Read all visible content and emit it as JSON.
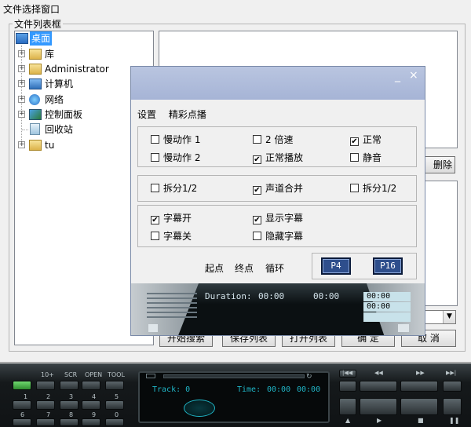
{
  "window": {
    "title": "文件选择窗口"
  },
  "group_label": "文件列表框",
  "tree": [
    {
      "label": "桌面",
      "selected": true,
      "icon": "desktop-icon"
    },
    {
      "label": "库",
      "icon": "library-icon"
    },
    {
      "label": "Administrator",
      "icon": "user-folder-icon"
    },
    {
      "label": "计算机",
      "icon": "computer-icon"
    },
    {
      "label": "网络",
      "icon": "network-icon"
    },
    {
      "label": "控制面板",
      "icon": "control-panel-icon"
    },
    {
      "label": "回收站",
      "icon": "recycle-bin-icon"
    },
    {
      "label": "tu",
      "icon": "folder-icon"
    }
  ],
  "buttons": {
    "delete": "删除",
    "start_search": "开始搜索",
    "save_list": "保存列表",
    "open_list": "打开列表",
    "ok": "确  定",
    "cancel": "取  消"
  },
  "popup": {
    "minimize": "_",
    "close": "×",
    "tabs": [
      "设置",
      "精彩点播"
    ],
    "speed": {
      "slow1": "慢动作 1",
      "x2": "2 倍速",
      "normal": "正常",
      "slow2": "慢动作 2",
      "normal_play": "正常播放",
      "mute": "静音",
      "slow1_checked": false,
      "x2_checked": false,
      "normal_checked": true,
      "slow2_checked": false,
      "normal_play_checked": true,
      "mute_checked": false
    },
    "channel": {
      "split_left": "拆分1/2",
      "merge": "声道合并",
      "split_right": "拆分1/2",
      "split_left_checked": false,
      "merge_checked": true,
      "split_right_checked": false
    },
    "subtitle": {
      "on": "字幕开",
      "show": "显示字幕",
      "off": "字幕关",
      "hide": "隐藏字幕",
      "on_checked": true,
      "show_checked": true,
      "off_checked": false,
      "hide_checked": false
    },
    "range": {
      "start": "起点",
      "end": "终点",
      "loop": "循环",
      "p4": "P4",
      "p16": "P16"
    },
    "strip": {
      "duration_label": "Duration:",
      "dur_a": "00:00",
      "dur_b": "00:00",
      "box1": "00:00",
      "box2": "00:00"
    }
  },
  "player": {
    "top_keys": [
      "10+",
      "SCR",
      "OPEN",
      "TOOL"
    ],
    "num_row1": [
      "1",
      "2",
      "3",
      "4",
      "5"
    ],
    "num_row2": [
      "6",
      "7",
      "8",
      "9",
      "0"
    ],
    "track": "Track: 0",
    "time_label": "Time:",
    "time_a": "00:00",
    "time_b": "00:00"
  }
}
